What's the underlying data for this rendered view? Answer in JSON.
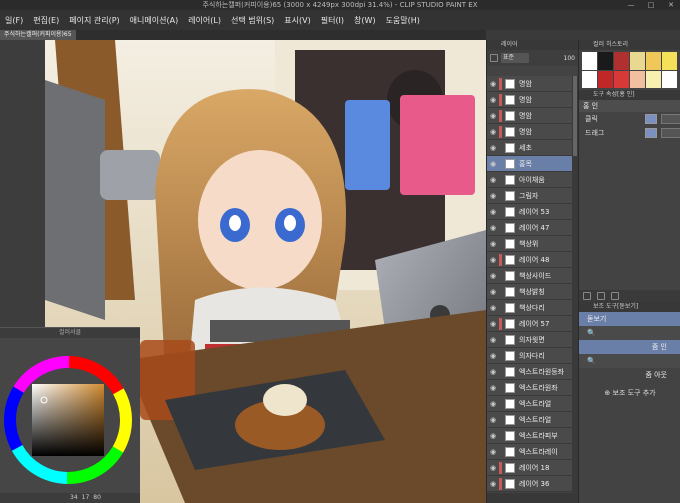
{
  "window": {
    "title": "주식하는캘퍼(커피이용)65 (3000 x 4249px 300dpi 31.4%) - CLIP STUDIO PAINT EX",
    "controls": [
      "—",
      "□",
      "✕"
    ]
  },
  "menu": [
    "일(F)",
    "편집(E)",
    "페이지 관리(P)",
    "애니메이션(A)",
    "레이어(L)",
    "선택 범위(S)",
    "표시(V)",
    "필터(I)",
    "창(W)",
    "도움말(H)"
  ],
  "doc_tab": "주식하는캘퍼(커피이용)65",
  "color_wheel": {
    "title": "컬러서클",
    "status": [
      "34",
      "17",
      "80"
    ],
    "hue_color": "#d08a30"
  },
  "layer_panel": {
    "title": "레이어",
    "blend_mode": "표준",
    "opacity": "100",
    "layers": [
      {
        "name": "명암",
        "type": "layer",
        "mask": true
      },
      {
        "name": "명암",
        "type": "layer",
        "mask": true
      },
      {
        "name": "명암",
        "type": "layer",
        "mask": true
      },
      {
        "name": "명암",
        "type": "layer",
        "mask": true
      },
      {
        "name": "세초",
        "type": "layer",
        "mask": false
      },
      {
        "name": "홍목",
        "type": "layer",
        "mask": false,
        "selected": true
      },
      {
        "name": "아이채움",
        "type": "layer",
        "mask": false
      },
      {
        "name": "그림자",
        "type": "layer",
        "mask": false
      },
      {
        "name": "레이어 53",
        "type": "layer",
        "mask": false
      },
      {
        "name": "레이어 47",
        "type": "layer",
        "mask": false
      },
      {
        "name": "책상위",
        "type": "layer",
        "mask": false
      },
      {
        "name": "레이어 48",
        "type": "layer",
        "mask": true
      },
      {
        "name": "책상사이드",
        "type": "layer",
        "mask": false
      },
      {
        "name": "책상밝칭",
        "type": "layer",
        "mask": false
      },
      {
        "name": "책상다리",
        "type": "layer",
        "mask": false
      },
      {
        "name": "레이어 57",
        "type": "layer",
        "mask": true
      },
      {
        "name": "의자윗면",
        "type": "layer",
        "mask": false
      },
      {
        "name": "의자다리",
        "type": "layer",
        "mask": false
      },
      {
        "name": "엑스트라원등좌",
        "type": "layer",
        "mask": false
      },
      {
        "name": "엑스트라원좌",
        "type": "layer",
        "mask": false
      },
      {
        "name": "엑스트라얼",
        "type": "layer",
        "mask": false
      },
      {
        "name": "엑스트라얼",
        "type": "layer",
        "mask": false
      },
      {
        "name": "엑스트라피부",
        "type": "layer",
        "mask": false
      },
      {
        "name": "엑스트라레이",
        "type": "layer",
        "mask": false
      },
      {
        "name": "레이어 18",
        "type": "layer",
        "mask": true
      },
      {
        "name": "레이어 36",
        "type": "layer",
        "mask": true
      }
    ]
  },
  "color_history": {
    "title": "컬러 히스토리",
    "swatches": [
      "#ffffff",
      "#1a1a1a",
      "#b03030",
      "#e8d890",
      "#f0c85a",
      "#f5e05a",
      "#ffffff",
      "#c02828",
      "#d83838",
      "#f0c0a0",
      "#f8f0b0",
      "#ffffff"
    ]
  },
  "tool_property": {
    "title": "도구 속성[홍 인]",
    "tool_name": "홍 인",
    "rows": [
      {
        "label": "클릭"
      },
      {
        "label": "드래그"
      }
    ]
  },
  "sub_tool": {
    "title": "보조 도구[돋보기]",
    "items": [
      {
        "label": "돋보기",
        "selected": true
      },
      {
        "label": "",
        "selected": false
      },
      {
        "label": "줌 인",
        "selected": true
      },
      {
        "label": "",
        "selected": false
      },
      {
        "label": "줌 아웃",
        "selected": false
      }
    ],
    "add_label": "보조 도구 추가"
  }
}
